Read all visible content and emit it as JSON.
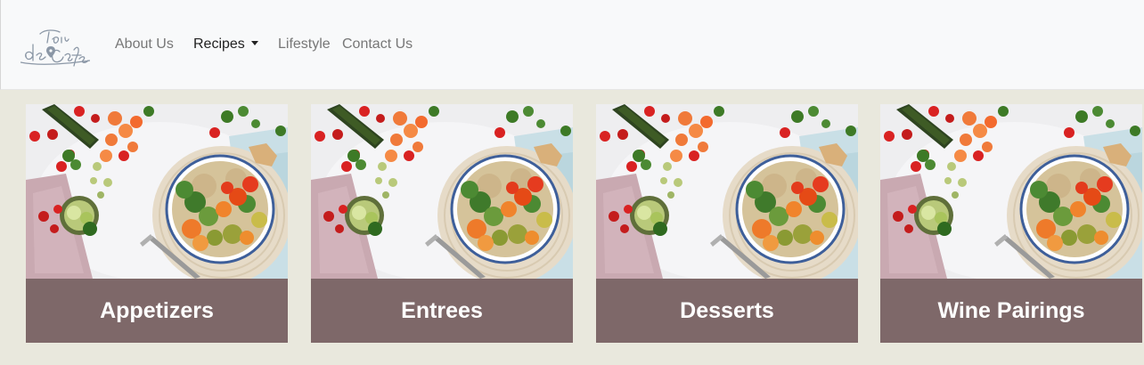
{
  "brand": {
    "logo_text_top": "Tour",
    "logo_text_bottom": "de Cafe"
  },
  "nav": {
    "items": [
      {
        "label": "About Us",
        "active": false
      },
      {
        "label": "Recipes",
        "active": true,
        "dropdown": true
      },
      {
        "label": "Lifestyle",
        "active": false
      },
      {
        "label": "Contact Us",
        "active": false
      }
    ]
  },
  "cards": [
    {
      "title": "Appetizers",
      "image": "salad-bowl-photo"
    },
    {
      "title": "Entrees",
      "image": "salad-bowl-photo"
    },
    {
      "title": "Desserts",
      "image": "salad-bowl-photo"
    },
    {
      "title": "Wine Pairings",
      "image": "salad-bowl-photo"
    }
  ],
  "colors": {
    "page_background": "#e9e8dd",
    "navbar_background": "#f8f9fa",
    "card_caption_background": "#7e6869",
    "caption_text": "#ffffff",
    "nav_text": "#777777",
    "nav_active_text": "#222222",
    "logo_color": "#8b97a6"
  }
}
